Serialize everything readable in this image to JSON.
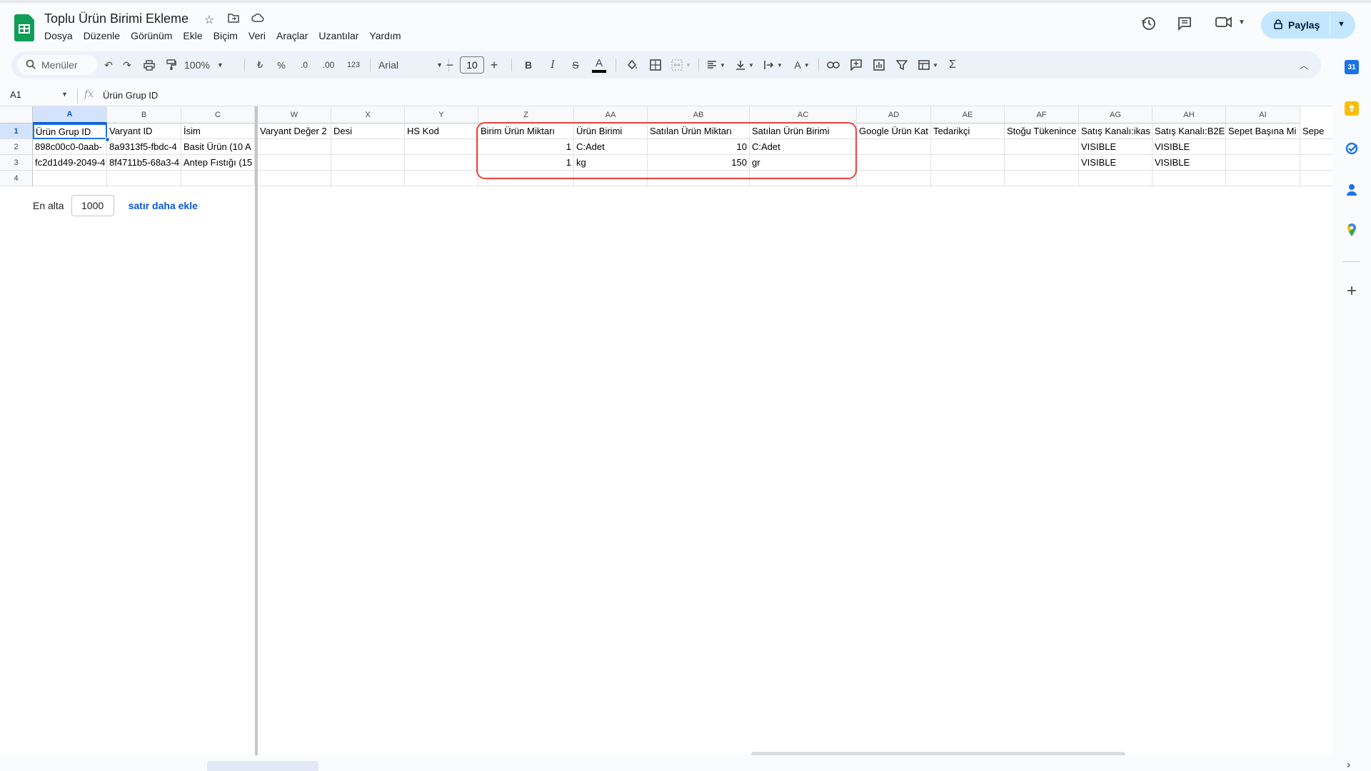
{
  "document": {
    "title": "Toplu Ürün Birimi Ekleme",
    "menus": [
      "Dosya",
      "Düzenle",
      "Görünüm",
      "Ekle",
      "Biçim",
      "Veri",
      "Araçlar",
      "Uzantılar",
      "Yardım"
    ],
    "share_label": "Paylaş"
  },
  "toolbar": {
    "search_label": "Menüler",
    "zoom": "100%",
    "currency": "₺",
    "percent": "%",
    "decimal_decrease": ".0",
    "decimal_increase": ".00",
    "number_format": "123",
    "font": "Arial",
    "font_size": "10"
  },
  "formula_bar": {
    "cell_ref": "A1",
    "fx": "fx",
    "value": "Ürün Grup ID"
  },
  "columns": [
    "A",
    "B",
    "C",
    "W",
    "X",
    "Y",
    "Z",
    "AA",
    "AB",
    "AC",
    "AD",
    "AE",
    "AF",
    "AG",
    "AH",
    "AI"
  ],
  "rows": [
    "1",
    "2",
    "3",
    "4"
  ],
  "cells": {
    "A1": "Ürün Grup ID",
    "B1": "Varyant ID",
    "C1": "İsim",
    "W1": "Varyant Değer 2",
    "X1": "Desi",
    "Y1": "HS Kod",
    "Z1": "Birim Ürün Miktarı",
    "AA1": "Ürün Birimi",
    "AB1": "Satılan Ürün Miktarı",
    "AC1": "Satılan Ürün Birimi",
    "AD1": "Google Ürün Kat",
    "AE1": "Tedarikçi",
    "AF1": "Stoğu Tükenince",
    "AG1": "Satış Kanalı:ikas",
    "AH1": "Satış Kanalı:B2E",
    "AI1": "Sepet Başına Mi",
    "AJ1": "Sepe",
    "A2": "898c00c0-0aab-",
    "B2": "8a9313f5-fbdc-4",
    "C2": "Basit Ürün (10 A",
    "Z2": "1",
    "AA2": "C:Adet",
    "AB2": "10",
    "AC2": "C:Adet",
    "AG2": "VISIBLE",
    "AH2": "VISIBLE",
    "A3": "fc2d1d49-2049-4",
    "B3": "8f4711b5-68a3-4",
    "C3": "Antep Fıstığı (15",
    "Z3": "1",
    "AA3": "kg",
    "AB3": "150",
    "AC3": "gr",
    "AG3": "VISIBLE",
    "AH3": "VISIBLE"
  },
  "add_rows": {
    "label": "En alta",
    "count": "1000",
    "button": "satır daha ekle"
  },
  "colors": {
    "highlight": "#e8453c",
    "selection": "#1a73e8",
    "share_bg": "#c2e7ff"
  }
}
